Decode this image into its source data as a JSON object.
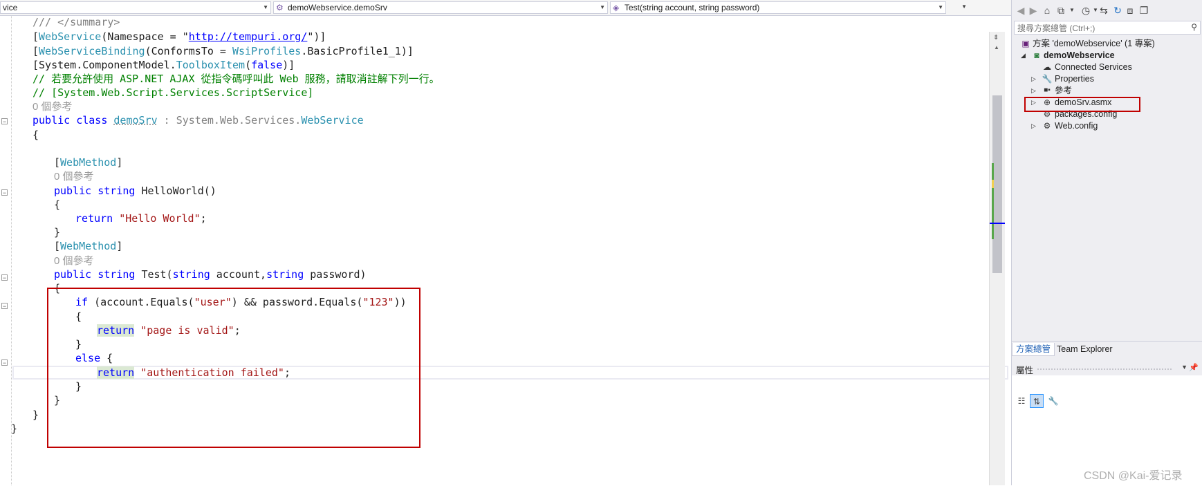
{
  "navbar": {
    "project_dropdown": "vice",
    "class_dropdown": "demoWebservice.demoSrv",
    "member_dropdown": "Test(string account, string password)"
  },
  "code": {
    "summary_comment": "/// </summary>",
    "line_attr1_a": "WebService",
    "line_attr1_b": "(Namespace = \"",
    "line_attr1_url": "http://tempuri.org/",
    "line_attr1_c": "\")]",
    "line_attr2_a": "WebServiceBinding",
    "line_attr2_b": "(ConformsTo = ",
    "line_attr2_c": "WsiProfiles",
    "line_attr2_d": ".BasicProfile1_1)]",
    "line_attr3_a": "[System.ComponentModel.",
    "line_attr3_b": "ToolboxItem",
    "line_attr3_c": "(",
    "line_attr3_d": "false",
    "line_attr3_e": ")]",
    "comment1": "// 若要允許使用 ASP.NET AJAX 從指令碼呼叫此 Web 服務，請取消註解下列一行。",
    "comment2": "// [System.Web.Script.Services.ScriptService]",
    "refs": "0 個參考",
    "class_kw": "public class ",
    "class_name": "demoSrv",
    "class_base_a": " : System.Web.Services.",
    "class_base_b": "WebService",
    "open_brace": "{",
    "close_brace": "}",
    "webmethod": "WebMethod",
    "helloworld_kw": "public string ",
    "helloworld_name": "HelloWorld()",
    "return_kw": "return ",
    "hello_str": "\"Hello World\"",
    "semicolon": ";",
    "test_kw1": "public string ",
    "test_name": "Test(",
    "test_kw2": "string",
    "test_p1": " account,",
    "test_kw3": "string",
    "test_p2": " password)",
    "if_kw": "if",
    "if_a": " (account.Equals(",
    "if_user": "\"user\"",
    "if_b": ") && password.Equals(",
    "if_123": "\"123\"",
    "if_c": "))",
    "return_hl": "return",
    "valid_str": " \"page is valid\"",
    "else_kw": "else",
    "else_brace": " {",
    "fail_str": " \"authentication failed\""
  },
  "solution_explorer": {
    "search_placeholder": "搜尋方案總管 (Ctrl+;)",
    "solution_label": "方案 'demoWebservice' (1 專案)",
    "project_label": "demoWebservice",
    "items": [
      {
        "label": "Connected Services"
      },
      {
        "label": "Properties"
      },
      {
        "label": "參考"
      },
      {
        "label": "demoSrv.asmx"
      },
      {
        "label": "packages.config"
      },
      {
        "label": "Web.config"
      }
    ],
    "tab_active": "方案總管",
    "tab_inactive": "Team Explorer"
  },
  "properties": {
    "title": "屬性"
  },
  "watermark": "CSDN @Kai-爱记录"
}
